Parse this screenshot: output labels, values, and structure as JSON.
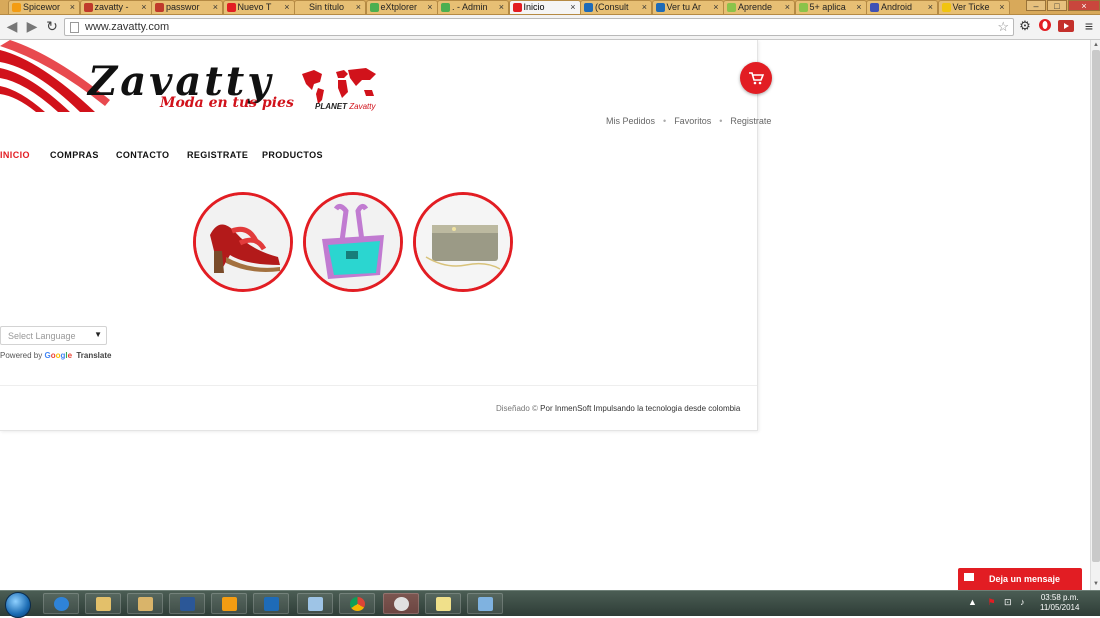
{
  "browser": {
    "tabs": [
      {
        "label": "Spicewor",
        "icon_color": "#f39c12"
      },
      {
        "label": "zavatty -",
        "icon_color": "#c0392b"
      },
      {
        "label": "passwor",
        "icon_color": "#c0392b"
      },
      {
        "label": "Nuevo T",
        "icon_color": "#e21d23"
      },
      {
        "label": "Sin título",
        "icon_color": ""
      },
      {
        "label": "eXtplorer",
        "icon_color": "#4caf50"
      },
      {
        "label": ". - Admin",
        "icon_color": "#4caf50"
      },
      {
        "label": "Inicio",
        "icon_color": "#e21d23",
        "active": true
      },
      {
        "label": "(Consult",
        "icon_color": "#1e6bb8"
      },
      {
        "label": "Ver tu Ar",
        "icon_color": "#1e6bb8"
      },
      {
        "label": "Aprende",
        "icon_color": "#8bc34a"
      },
      {
        "label": "5+ aplica",
        "icon_color": "#8bc34a"
      },
      {
        "label": "Android",
        "icon_color": "#3f51b5"
      },
      {
        "label": "Ver Ticke",
        "icon_color": "#f1c40f"
      }
    ],
    "close_glyph": "×",
    "url": "www.zavatty.com",
    "window_controls": {
      "minimize": "–",
      "maximize": "□",
      "close": "×"
    }
  },
  "site": {
    "logo": {
      "brand": "Zavatty",
      "tagline": "Moda en tus pies",
      "planet_label": "PLANET",
      "planet_brand": "Zavatty"
    },
    "top_links": [
      "Mis Pedidos",
      "Favoritos",
      "Registrate"
    ],
    "link_separator": "•",
    "nav": [
      {
        "label": "INICIO",
        "active": true
      },
      {
        "label": "COMPRAS"
      },
      {
        "label": "CONTACTO"
      },
      {
        "label": "REGISTRATE"
      },
      {
        "label": "PRODUCTOS"
      }
    ],
    "products": [
      {
        "name": "sandal-icon"
      },
      {
        "name": "handbag-icon"
      },
      {
        "name": "clutch-icon"
      }
    ],
    "language_select": {
      "placeholder": "Select Language",
      "arrow": "▼"
    },
    "powered_by": {
      "prefix": "Powered by",
      "google": "Google",
      "translate": "Translate"
    },
    "footer": {
      "designed": "Diseñado ©",
      "by": "Por InmenSoft Impulsando la tecnologia desde colombia"
    },
    "chat_button": "Deja un mensaje",
    "accent_color": "#e21d23"
  },
  "taskbar": {
    "clock_time": "03:58 p.m.",
    "clock_date": "11/05/2014",
    "tray_up_arrow": "▲"
  }
}
